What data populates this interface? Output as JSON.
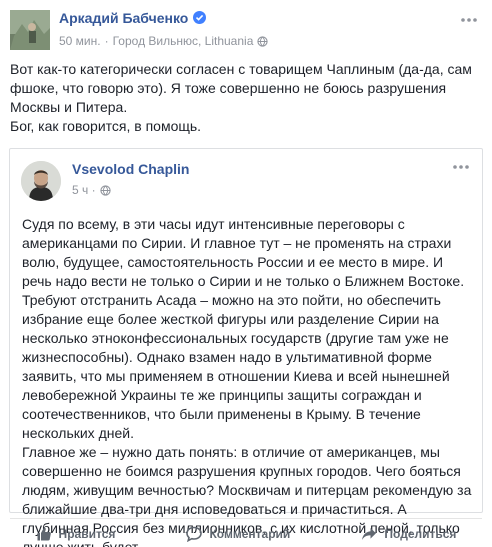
{
  "post": {
    "author": "Аркадий Бабченко",
    "time": "50 мин.",
    "separator": "·",
    "location": "Город Вильнюс, Lithuania",
    "text": [
      "Вот как-то категорически согласен с товарищем Чаплиным (да-да, сам фшоке, что говорю это). Я тоже совершенно не боюсь разрушения Москвы и Питера.",
      "Бог, как говорится, в помощь."
    ],
    "icons": {
      "verified": "verified-badge-icon",
      "privacy": "globe-icon",
      "more": "more-options-icon"
    }
  },
  "shared": {
    "author": "Vsevolod Chaplin",
    "time": "5 ч",
    "separator": "·",
    "text": [
      "Судя по всему, в эти часы идут интенсивные переговоры с американцами по Сирии. И главное тут – не променять на страхи волю, будущее, самостоятельность России и ее место в мире. И речь надо вести не только о Сирии и не только о Ближнем Востоке. Требуют отстранить Асада – можно на это пойти, но обеспечить избрание еще более жесткой фигуры или разделение Сирии на несколько этноконфессиональных государств (другие там уже не жизнеспособны). Однако взамен надо в ультимативной форме заявить, что мы применяем в отношении Киева и всей нынешней левобережной Украины те же принципы защиты сограждан и соотечественников, что были применены в Крыму. В течение нескольких дней.",
      "Главное же – нужно дать понять: в отличие от американцев, мы совершенно не боимся разрушения крупных городов. Чего бояться людям, живущим вечностью? Москвичам и питерцам рекомендую за ближайшие два-три дня исповедоваться и причаститься. А глубинная Россия без миллионников, с их кислотной пеной, только лучше жить будет."
    ]
  },
  "actions": {
    "like": "Нравится",
    "comment": "Комментарий",
    "share": "Поделиться"
  },
  "colors": {
    "link": "#365899",
    "meta": "#90949c",
    "text": "#1d2129",
    "verified": "#4080ff",
    "action": "#606770"
  }
}
